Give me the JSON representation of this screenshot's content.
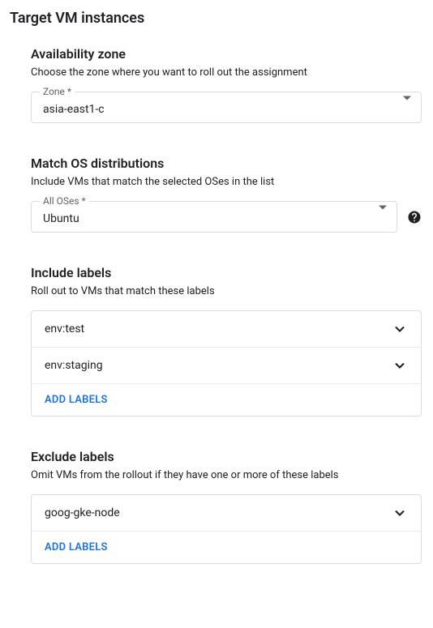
{
  "page": {
    "title": "Target VM instances"
  },
  "availability": {
    "title": "Availability zone",
    "desc": "Choose the zone where you want to roll out the assignment",
    "field_label": "Zone *",
    "value": "asia-east1-c"
  },
  "os": {
    "title": "Match OS distributions",
    "desc": "Include VMs that match the selected OSes in the list",
    "field_label": "All OSes *",
    "value": "Ubuntu"
  },
  "include": {
    "title": "Include labels",
    "desc": "Roll out to VMs that match these labels",
    "items": [
      "env:test",
      "env:staging"
    ],
    "add_label": "ADD LABELS"
  },
  "exclude": {
    "title": "Exclude labels",
    "desc": "Omit VMs from the rollout if they have one or more of these labels",
    "items": [
      "goog-gke-node"
    ],
    "add_label": "ADD LABELS"
  }
}
